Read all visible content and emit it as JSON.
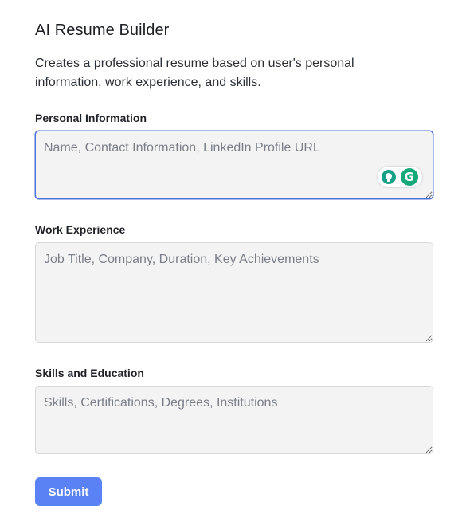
{
  "app": {
    "title": "AI Resume Builder",
    "description": "Creates a professional resume based on user's personal information, work experience, and skills."
  },
  "form": {
    "fields": [
      {
        "label": "Personal Information",
        "placeholder": "Name, Contact Information, LinkedIn Profile URL",
        "value": "",
        "focused": true
      },
      {
        "label": "Work Experience",
        "placeholder": "Job Title, Company, Duration, Key Achievements",
        "value": "",
        "focused": false
      },
      {
        "label": "Skills and Education",
        "placeholder": "Skills, Certifications, Degrees, Institutions",
        "value": "",
        "focused": false
      }
    ],
    "submit_label": "Submit"
  },
  "grammarly": {
    "logo_letter": "G",
    "icons": [
      "lightbulb-icon",
      "grammarly-logo-icon"
    ],
    "brand_color": "#15a87a"
  },
  "colors": {
    "accent": "#5b82f5",
    "focus_border": "#4d72d9",
    "field_bg": "#f3f3f4"
  }
}
